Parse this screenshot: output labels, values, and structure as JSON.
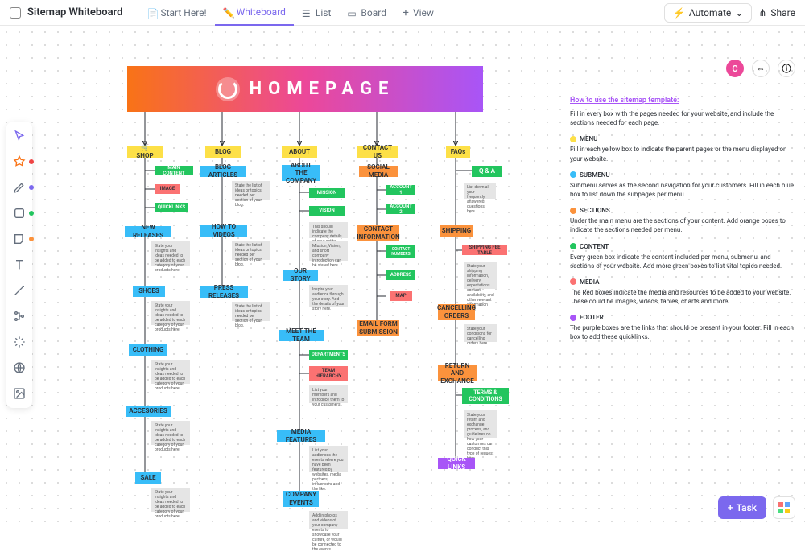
{
  "header": {
    "title": "Sitemap Whiteboard",
    "tabs": [
      {
        "label": "Start Here!"
      },
      {
        "label": "Whiteboard"
      },
      {
        "label": "List"
      },
      {
        "label": "Board"
      },
      {
        "label": "View"
      }
    ],
    "automate": "Automate",
    "share": "Share"
  },
  "homepage": "HOMEPAGE",
  "avatar_letter": "C",
  "task_button": "Task",
  "menus": {
    "shop": "🛒 SHOP",
    "blog": "BLOG",
    "about": "ABOUT",
    "contact": "CONTACT US",
    "faqs": "FAQs"
  },
  "nodes": {
    "main_content": "MAIN CONTENT",
    "image": "IMAGE",
    "quicklinks": "QUICKLINKS",
    "new_releases": "NEW RELEASES",
    "shoes": "SHOES",
    "clothing": "CLOTHING",
    "accessories": "ACCESORIES",
    "sale": "SALE",
    "blog_articles": "BLOG ARTICLES",
    "how_to_videos": "HOW TO VIDEOS",
    "press_releases": "PRESS RELEASES",
    "about_company": "ABOUT THE COMPANY",
    "mission": "MISSION",
    "vision": "VISION",
    "our_story": "OUR STORY",
    "meet_team": "MEET THE TEAM",
    "departments": "DEPARTMENTS",
    "team_hierarchy": "TEAM HIERARCHY",
    "media_features": "MEDIA FEATURES",
    "company_events": "COMPANY EVENTS",
    "social_media": "SOCIAL MEDIA",
    "account1": "ACCOUNT 1",
    "account2": "ACCOUNT 2",
    "contact_info": "CONTACT INFORMATION",
    "contact_numbers": "CONTACT NUMBERS",
    "address": "ADDRESS",
    "map": "MAP",
    "email_form": "EMAIL FORM SUBMISSION",
    "qa": "Q & A",
    "shipping": "SHIPPING",
    "shipping_fee": "SHIPPING FEE TABLE",
    "cancelling": "CANCELLING ORDERS",
    "return_exchange": "RETURN AND EXCHANGE",
    "terms": "TERMS & CONDITIONS",
    "quick_links": "QUICK LINKS"
  },
  "gray_notes": {
    "shop1": "State your insights and ideas needed to be added to each category of your products here.",
    "shop2": "State your insights and ideas needed to be added to each category of your products here.",
    "shop3": "State your insights and ideas needed to be added to each category of your products here.",
    "shop4": "State your insights and ideas needed to be added to each category of your products here.",
    "shop5": "State your insights and ideas needed to be added to each category of your products here.",
    "blog1": "State the list of ideas or topics needed per section of your blog.",
    "blog2": "State the list of ideas or topics needed per section of your blog.",
    "blog3": "State the list of ideas or topics needed per section of your blog.",
    "about1": "This should indicate the company details of your entity.",
    "about2": "Mission, Vision, and short company introduction can be stated here.",
    "about3": "Inspire your audience through your story. Add the details of your story here.",
    "about4": "List your members and introduce them to your customers.",
    "about5": "List your audiences the events where you have been featured by websites, media partners, influencers and the like.",
    "about6": "Add in photos and videos of your company events to showcase your culture, or would be connected to the events.",
    "faq1": "List down all your frequently answered questions here.",
    "faq2": "State your shipping information, delivery expectations contact availability, and other relevant information here.",
    "faq3": "State your conditions for cancelling orders here.",
    "faq4": "State your return and exchange process, and guidelines on how your customers can conduct this type of request here."
  },
  "info": {
    "title": "How to use the sitemap template:",
    "intro": "Fill in every box with the pages needed for your website, and include the sections needed for each page.",
    "menu_h": "MENU",
    "menu_t": "Fill in each yellow box to indicate the parent pages or the menu displayed on your website.",
    "submenu_h": "SUBMENU",
    "submenu_t": "Submenu serves as the second navigation for your customers. Fill in each blue box to list down the subpages per menu.",
    "sections_h": "SECTIONS",
    "sections_t": "Under the main menu are the sections of your content. Add orange boxes to indicate the sections needed per menu.",
    "content_h": "CONTENT",
    "content_t": "Every green box indicate the content included per menu, submenu, and sections of your website. Add more green boxes to list vital topics needed.",
    "media_h": "MEDIA",
    "media_t": "The Red boxes indicate the media and resources to be added to your website. These could be images, videos, tables, charts and more.",
    "footer_h": "FOOTER",
    "footer_t": "The purple boxes are the links that should be present in your footer. Fill in each box to add these quicklinks."
  }
}
